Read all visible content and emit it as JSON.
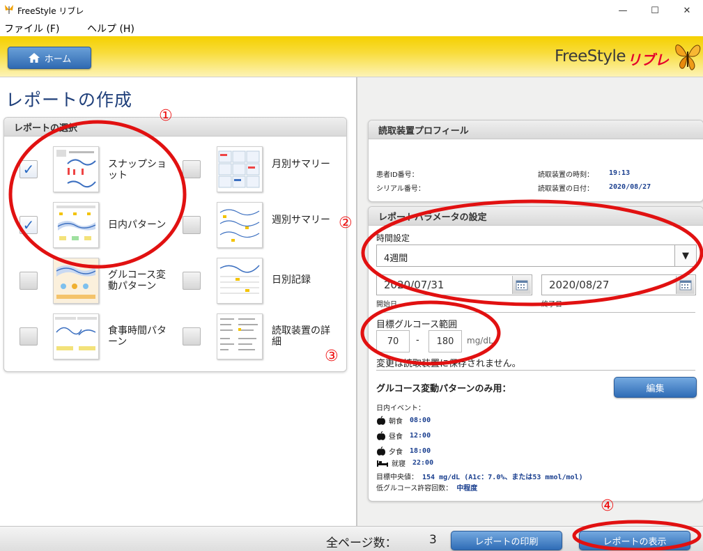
{
  "window": {
    "title": "FreeStyle リブレ",
    "controls": {
      "minimize": "—",
      "maximize": "☐",
      "close": "✕"
    }
  },
  "menu": {
    "items": [
      "ファイル (F)",
      "ヘルプ (H)"
    ]
  },
  "header": {
    "home_label": "ホーム",
    "logo_main": "FreeStyle",
    "logo_sub": "リブレ"
  },
  "left": {
    "page_title": "レポートの作成",
    "panel_title": "レポートの選択",
    "reports": [
      {
        "label": "スナップショット",
        "checked": true
      },
      {
        "label": "月別サマリー",
        "checked": false
      },
      {
        "label": "日内パターン",
        "checked": true
      },
      {
        "label": "週別サマリー",
        "checked": false
      },
      {
        "label": "グルコース変動パターン",
        "checked": false
      },
      {
        "label": "日別記録",
        "checked": false
      },
      {
        "label": "食事時間パターン",
        "checked": false
      },
      {
        "label": "読取装置の詳細",
        "checked": false
      }
    ]
  },
  "profile": {
    "title": "読取装置プロフィール",
    "patient_id_label": "患者ID番号：",
    "serial_label": "シリアル番号：",
    "serial_value": "",
    "time_label": "読取装置の時刻：",
    "time_value": "19:13",
    "date_label": "読取装置の日付：",
    "date_value": "2020/08/27"
  },
  "params": {
    "title": "レポートパラメータの設定",
    "period_label": "時間設定",
    "period_value": "4週間",
    "start_date": "2020/07/31",
    "start_label": "開始日",
    "end_date": "2020/08/27",
    "end_label": "終了日",
    "target_label": "目標グルコース範囲",
    "target_low": "70",
    "target_dash": "-",
    "target_high": "180",
    "target_unit": "mg/dL",
    "not_saved_note": "変更は読取装置に保存されません。",
    "agp_only_label": "グルコース変動パターンのみ用：",
    "edit_label": "編集",
    "events_label": "日内イベント：",
    "events": [
      {
        "name": "朝食",
        "time": "08:00",
        "icon": "apple-icon"
      },
      {
        "name": "昼食",
        "time": "12:00",
        "icon": "apple-icon"
      },
      {
        "name": "夕食",
        "time": "18:00",
        "icon": "apple-icon"
      },
      {
        "name": "就寝",
        "time": "22:00",
        "icon": "bed-icon"
      }
    ],
    "median_label": "目標中央値：",
    "median_value": "154 mg/dL (A1c：7.0%、または53 mmol/mol)",
    "hypo_label": "低グルコース許容回数：",
    "hypo_value": "中程度"
  },
  "bottom": {
    "pages_label": "全ページ数：",
    "pages_value": "3",
    "print_label": "レポートの印刷",
    "show_label": "レポートの表示"
  },
  "annotations": [
    "①",
    "②",
    "③",
    "④"
  ],
  "colors": {
    "header_yellow": "#f5d000",
    "button_blue": "#2f6cb6",
    "annotation_red": "#e11111",
    "title_blue": "#1f3f7a"
  }
}
